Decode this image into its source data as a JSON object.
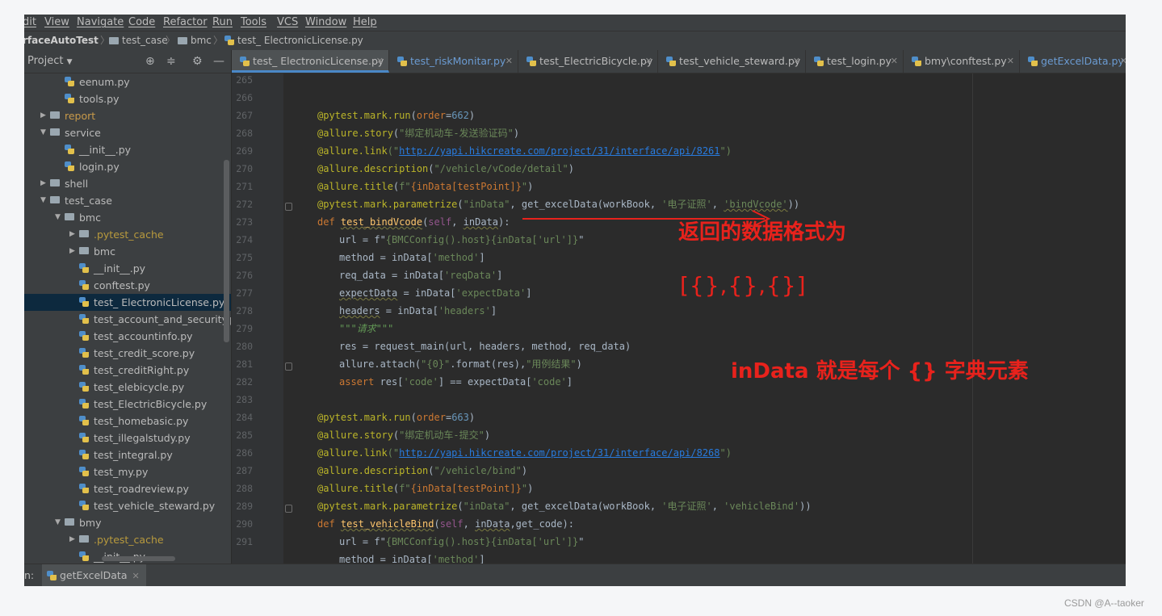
{
  "menubar": {
    "items": [
      "dit",
      "View",
      "Navigate",
      "Code",
      "Refactor",
      "Run",
      "Tools",
      "VCS",
      "Window",
      "Help"
    ]
  },
  "navbar": {
    "project": "rfaceAutoTest",
    "crumbs": [
      "test_case",
      "bmc",
      "test_ ElectronicLicense.py"
    ]
  },
  "project_panel": {
    "title": "Project",
    "icons": [
      "target-icon",
      "collapse-icon",
      "gear-icon",
      "minimize-icon"
    ],
    "tree": [
      {
        "label": "eenum.py",
        "type": "py"
      },
      {
        "label": "tools.py",
        "type": "py"
      },
      {
        "label": "report",
        "type": "folder",
        "state": "orange"
      },
      {
        "label": "service",
        "type": "folder",
        "state": "expanded"
      },
      {
        "label": "__init__.py",
        "type": "py"
      },
      {
        "label": "login.py",
        "type": "py"
      },
      {
        "label": "shell",
        "type": "folder"
      },
      {
        "label": "test_case",
        "type": "folder",
        "state": "expanded"
      },
      {
        "label": "bmc",
        "type": "folder",
        "state": "expanded"
      },
      {
        "label": ".pytest_cache",
        "type": "folder",
        "state": "excluded"
      },
      {
        "label": "bmc",
        "type": "folder"
      },
      {
        "label": "__init__.py",
        "type": "py"
      },
      {
        "label": "conftest.py",
        "type": "py"
      },
      {
        "label": "test_ ElectronicLicense.py",
        "type": "py",
        "state": "selected"
      },
      {
        "label": "test_account_and_security.py",
        "type": "py"
      },
      {
        "label": "test_accountinfo.py",
        "type": "py"
      },
      {
        "label": "test_credit_score.py",
        "type": "py"
      },
      {
        "label": "test_creditRight.py",
        "type": "py"
      },
      {
        "label": "test_elebicycle.py",
        "type": "py"
      },
      {
        "label": "test_ElectricBicycle.py",
        "type": "py"
      },
      {
        "label": "test_homebasic.py",
        "type": "py"
      },
      {
        "label": "test_illegalstudy.py",
        "type": "py"
      },
      {
        "label": "test_integral.py",
        "type": "py"
      },
      {
        "label": "test_my.py",
        "type": "py"
      },
      {
        "label": "test_roadreview.py",
        "type": "py"
      },
      {
        "label": "test_vehicle_steward.py",
        "type": "py"
      },
      {
        "label": "bmy",
        "type": "folder",
        "state": "expanded"
      },
      {
        "label": ".pytest_cache",
        "type": "folder",
        "state": "excluded"
      },
      {
        "label": "__init__.py",
        "type": "py"
      }
    ]
  },
  "tabs": [
    {
      "label": "test_ ElectronicLicense.py",
      "active": true
    },
    {
      "label": "test_riskMonitar.py",
      "blue": true
    },
    {
      "label": "test_ElectricBicycle.py"
    },
    {
      "label": "test_vehicle_steward.py"
    },
    {
      "label": "test_login.py"
    },
    {
      "label": "bmy\\conftest.py"
    },
    {
      "label": "getExcelData.py",
      "blue": true
    }
  ],
  "editor": {
    "line_numbers": [
      "265",
      "266",
      "267",
      "268",
      "269",
      "270",
      "271",
      "272",
      "273",
      "274",
      "275",
      "276",
      "277",
      "278",
      "279",
      "280",
      "281",
      "282",
      "283",
      "284",
      "285",
      "286",
      "287",
      "288",
      "289",
      "290",
      "291"
    ],
    "block1": {
      "order_line": [
        "@pytest.mark.run",
        "(",
        "order",
        "=",
        "662",
        ")"
      ],
      "story": [
        "@allure.story",
        "(",
        "\"绑定机动车-发送验证码\"",
        ")"
      ],
      "link": [
        "@allure.link",
        "(\"",
        "http://yapi.hikcreate.com/project/31/interface/api/8261",
        "\")"
      ],
      "description": [
        "@allure.description",
        "(",
        "\"/vehicle/vCode/detail\"",
        ")"
      ],
      "title": [
        "@allure.title",
        "(",
        "f\"",
        "{inData[testPoint]}",
        "\"",
        ")"
      ],
      "parametrize": [
        "@pytest.mark.parametrize",
        "(",
        "\"inData\"",
        ", get_excelData(workBook, ",
        "'电子证照'",
        ", ",
        "'bindVcode'",
        "))"
      ],
      "def": [
        "def ",
        "test_bindVcode",
        "(",
        "self",
        ", ",
        "inData",
        "):"
      ],
      "body": [
        [
          "url = f\"",
          "{BMCConfig().host}{inData['url']}",
          "\""
        ],
        [
          "method = inData[",
          "'method'",
          "]"
        ],
        [
          "req_data = inData[",
          "'reqData'",
          "]"
        ],
        [
          "expectData",
          " = inData[",
          "'expectData'",
          "]"
        ],
        [
          "headers",
          " = inData[",
          "'headers'",
          "]"
        ],
        [
          "\"\"\"请求\"\"\""
        ],
        [
          "res = request_main(url, headers, method, req_data)"
        ],
        [
          "allure.attach(",
          "\"{0}\"",
          ".format(res),",
          "\"用例结果\"",
          ")"
        ],
        [
          "assert ",
          "res[",
          "'code'",
          "] == expectData[",
          "'code'",
          "]"
        ]
      ]
    },
    "block2": {
      "order_line": [
        "@pytest.mark.run",
        "(",
        "order",
        "=",
        "663",
        ")"
      ],
      "story": [
        "@allure.story",
        "(",
        "\"绑定机动车-提交\"",
        ")"
      ],
      "link": [
        "@allure.link",
        "(\"",
        "http://yapi.hikcreate.com/project/31/interface/api/8268",
        "\")"
      ],
      "description": [
        "@allure.description",
        "(",
        "\"/vehicle/bind\"",
        ")"
      ],
      "title": [
        "@allure.title",
        "(",
        "f\"",
        "{inData[testPoint]}",
        "\"",
        ")"
      ],
      "parametrize": [
        "@pytest.mark.parametrize",
        "(",
        "\"inData\"",
        ", get_excelData(workBook, ",
        "'电子证照'",
        ", ",
        "'vehicleBind'",
        "))"
      ],
      "def": [
        "def ",
        "test_vehicleBind",
        "(",
        "self",
        ", ",
        "inData",
        ",get_code):"
      ],
      "body": [
        [
          "url = f\"",
          "{BMCConfig().host}{inData['url']}",
          "\""
        ],
        [
          "method = inData[",
          "'method'",
          "]"
        ]
      ]
    }
  },
  "annotations": {
    "line1": "返回的数据格式为",
    "line2": "[{},{},{}]",
    "line3": "inData 就是每个  {} 字典元素",
    "color": "#e8221c"
  },
  "runbar": {
    "prefix": "n:",
    "tab": "getExcelData"
  },
  "watermark": "CSDN @A--taoker"
}
